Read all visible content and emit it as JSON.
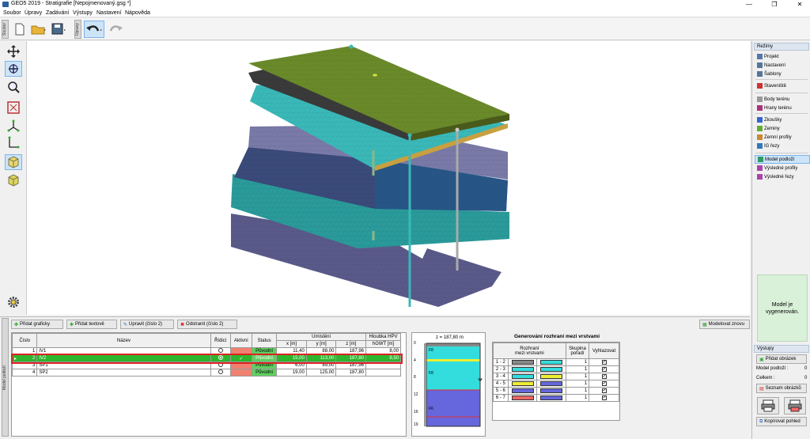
{
  "window": {
    "title": "GEO5 2019 - Stratigrafie [Nepojmenovaný.gsg *]",
    "min": "—",
    "max": "❐",
    "close": "✕"
  },
  "menu": [
    "Soubor",
    "Úpravy",
    "Zadávání",
    "Výstupy",
    "Nastavení",
    "Nápověda"
  ],
  "toolbar": {
    "tab_soubor": "Soubor",
    "tab_upravy": "Úpravy"
  },
  "right": {
    "header": "Režimy",
    "items": [
      {
        "label": "Projekt",
        "color": "#5577aa"
      },
      {
        "label": "Nastavení",
        "color": "#557799"
      },
      {
        "label": "Šablony",
        "color": "#557799"
      },
      {
        "label": "Staveniště",
        "color": "#cc3333"
      },
      {
        "label": "Body terénu",
        "color": "#999999"
      },
      {
        "label": "Hrany terénu",
        "color": "#aa3377"
      },
      {
        "label": "Zkoušky",
        "color": "#3366cc"
      },
      {
        "label": "Zeminy",
        "color": "#66aa33"
      },
      {
        "label": "Zemní profily",
        "color": "#cc8833"
      },
      {
        "label": "IG řezy",
        "color": "#3377bb"
      },
      {
        "label": "Model podloží",
        "color": "#339966"
      },
      {
        "label": "Výsledné profily",
        "color": "#aa44aa"
      },
      {
        "label": "Výsledné řezy",
        "color": "#aa44aa"
      }
    ],
    "status": "Model je vygenerován.",
    "outputs_header": "Výstupy",
    "add_image": "Přidat obrázek",
    "model_label": "Model podloží :",
    "model_val": "0",
    "total_label": "Celkem :",
    "total_val": "0",
    "image_list": "Seznam obrázků",
    "copy_view": "Kopírovat pohled"
  },
  "bottom": {
    "side_label": "Model podloží",
    "btn_add_graphic": "Přidat graficky",
    "btn_add_text": "Přidat textově",
    "btn_edit": "Upravit (číslo 2)",
    "btn_remove": "Odstranit (číslo 2)",
    "btn_regen": "Modelovat znovu",
    "headers": {
      "cislo": "Číslo",
      "nazev": "Název",
      "ridici": "Řídicí",
      "aktivni": "Aktivní",
      "status": "Status",
      "umisteni": "Umístění",
      "hloubka": "Hloubka HPV",
      "x": "x [m]",
      "y": "y [m]",
      "z": "z [m]",
      "hgwt": "hGWT [m]"
    },
    "rows": [
      {
        "n": "1",
        "name": "IV1",
        "status": "Původní",
        "x": "11,40",
        "y": "88,00",
        "z": "187,96",
        "h": "8,00",
        "sel": false
      },
      {
        "n": "2",
        "name": "IV2",
        "status": "Původní",
        "x": "15,00",
        "y": "113,00",
        "z": "187,80",
        "h": "8,50",
        "sel": true
      },
      {
        "n": "3",
        "name": "SP1",
        "status": "Původní",
        "x": "6,00",
        "y": "89,00",
        "z": "187,96",
        "h": "",
        "sel": false
      },
      {
        "n": "4",
        "name": "SP2",
        "status": "Původní",
        "x": "19,00",
        "y": "125,00",
        "z": "187,80",
        "h": "",
        "sel": false
      }
    ],
    "row_arrow": "▸",
    "check": "✓",
    "profile": {
      "z": "z = 187,80 m",
      "ticks": [
        "0",
        "4",
        "8",
        "12",
        "16",
        "19"
      ],
      "layers": [
        "F8",
        "F8",
        "F6"
      ]
    },
    "interface": {
      "title": "Generování rozhraní mezi vrstvami",
      "h_roz": "Rozhraní",
      "h_roz2": "mezi vrstvami",
      "h_skup": "Skupina",
      "h_skup2": "pořadí",
      "h_vyhl": "Vyhlazovat",
      "rows": [
        {
          "pair": "1 - 2",
          "a": "#888888",
          "b": "#33dddd",
          "g": "1",
          "v": "✓"
        },
        {
          "pair": "2 - 3",
          "a": "#33dddd",
          "b": "#33dddd",
          "g": "1",
          "v": "✓"
        },
        {
          "pair": "3 - 4",
          "a": "#33dddd",
          "b": "#eeee33",
          "g": "1",
          "v": "✓"
        },
        {
          "pair": "4 - 5",
          "a": "#eeee33",
          "b": "#6666dd",
          "g": "1",
          "v": "✓"
        },
        {
          "pair": "5 - 6",
          "a": "#6666dd",
          "b": "#6666dd",
          "g": "1",
          "v": "✓"
        },
        {
          "pair": "6 - 7",
          "a": "#ee6666",
          "b": "#6666dd",
          "g": "1",
          "v": "✓"
        }
      ]
    }
  }
}
